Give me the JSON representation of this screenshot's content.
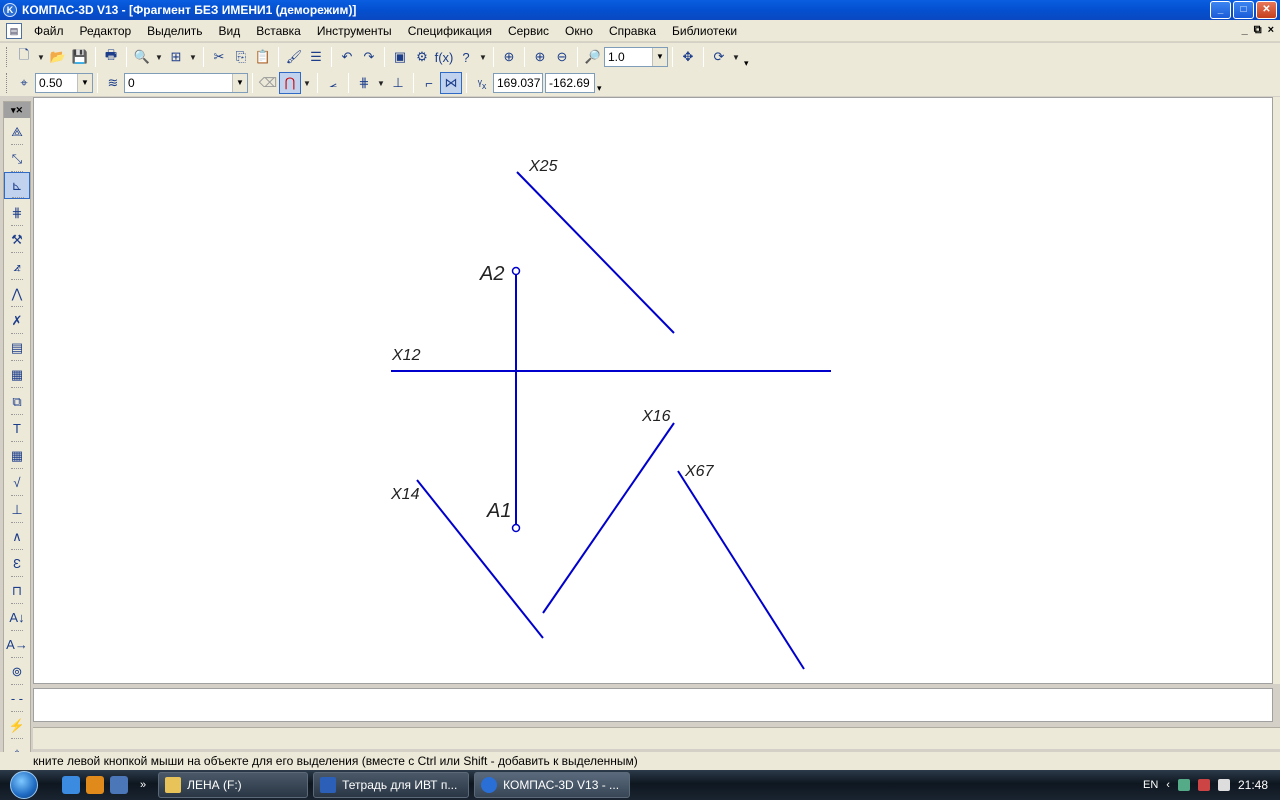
{
  "window": {
    "title": "КОМПАС-3D V13 - [Фрагмент БЕЗ ИМЕНИ1 (деморежим)]",
    "buttons": {
      "minimize": "_",
      "maximize": "□",
      "close": "✕"
    }
  },
  "menu": {
    "items": [
      "Файл",
      "Редактор",
      "Выделить",
      "Вид",
      "Вставка",
      "Инструменты",
      "Спецификация",
      "Сервис",
      "Окно",
      "Справка",
      "Библиотеки"
    ],
    "mdi": {
      "minimize": "_",
      "restore": "⧉",
      "close": "×"
    }
  },
  "toolbar1": {
    "zoom_value": "1.0",
    "fx_label": "f(x)"
  },
  "toolbar2": {
    "step_value": "0.50",
    "layer_value": "0",
    "coord_x": "169.037",
    "coord_y": "-162.69"
  },
  "drawing": {
    "labels": {
      "x25": "X25",
      "a2": "A2",
      "x12": "X12",
      "x16": "X16",
      "x67": "X67",
      "x14": "X14",
      "a1": "A1"
    },
    "line_color": "#0000cc"
  },
  "status": {
    "text": "кните левой кнопкой мыши на объекте для его выделения (вместе с Ctrl или Shift - добавить к выделенным)"
  },
  "taskbar": {
    "tasks": [
      "ЛЕНА (F:)",
      "Тетрадь для ИВТ п...",
      "КОМПАС-3D V13 - ..."
    ],
    "lang": "EN",
    "clock": "21:48"
  }
}
